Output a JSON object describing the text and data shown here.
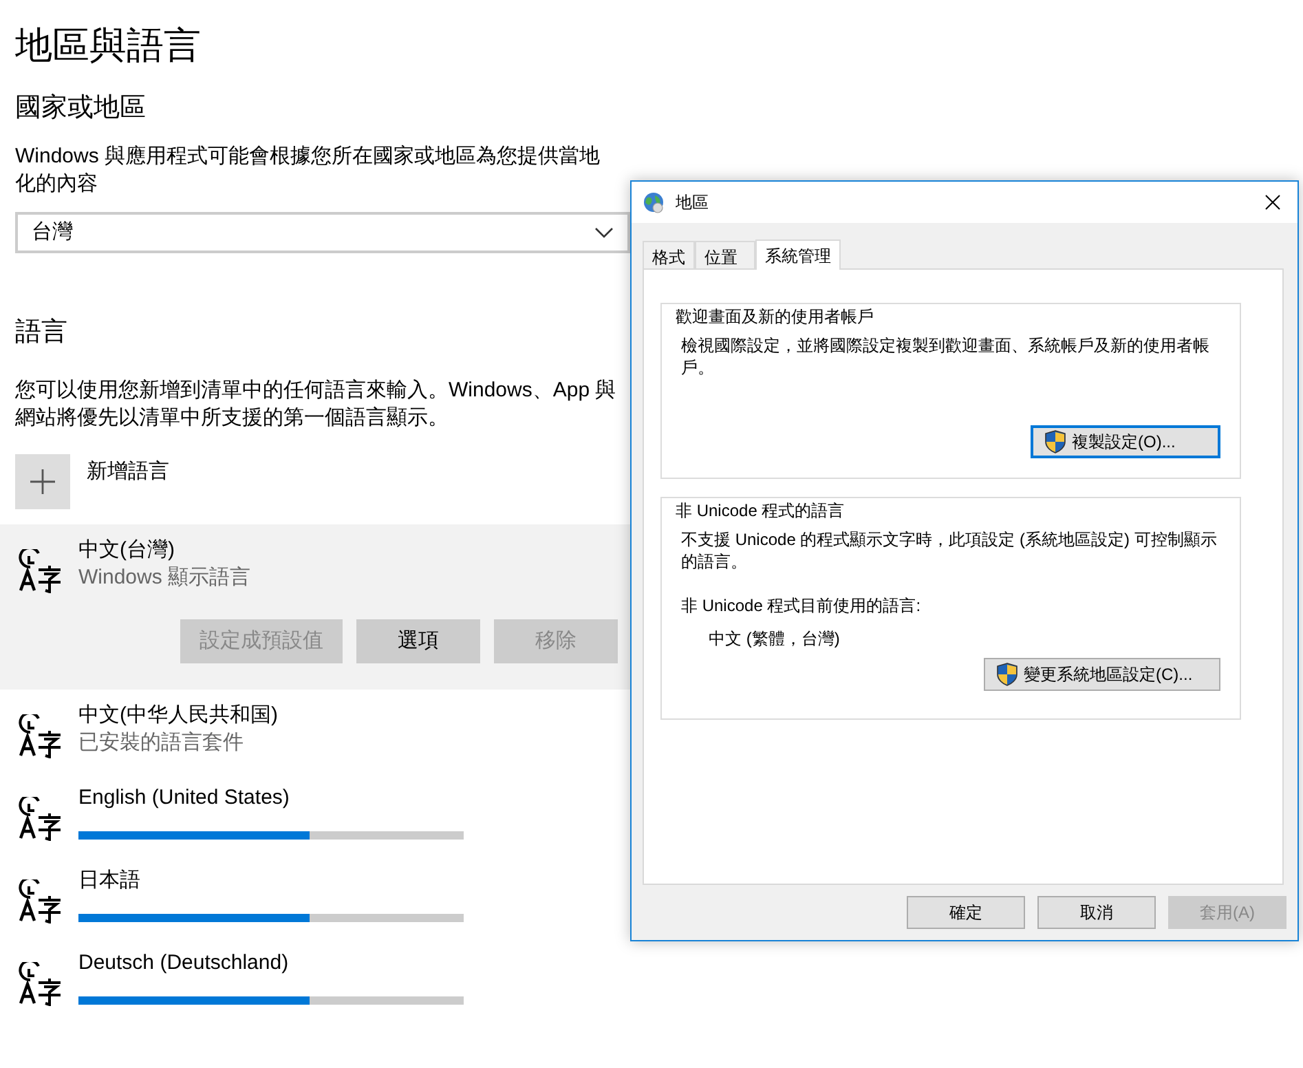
{
  "page": {
    "title": "地區與語言",
    "country_section": {
      "heading": "國家或地區",
      "description": "Windows 與應用程式可能會根據您所在國家或地區為您提供當地化的內容",
      "dropdown": {
        "value": "台灣"
      }
    },
    "language_section": {
      "heading": "語言",
      "description": "您可以使用您新增到清單中的任何語言來輸入。Windows、App 與網站將優先以清單中所支援的第一個語言顯示。",
      "add_button": {
        "label": "新增語言"
      },
      "languages": [
        {
          "name": "中文(台灣)",
          "subtitle": "Windows 顯示語言",
          "selected": true,
          "actions": [
            {
              "label": "設定成預設值",
              "disabled": true
            },
            {
              "label": "選項",
              "disabled": false
            },
            {
              "label": "移除",
              "disabled": true
            }
          ]
        },
        {
          "name": "中文(中华人民共和国)",
          "subtitle": "已安裝的語言套件",
          "selected": false
        },
        {
          "name": "English (United States)",
          "level": 0.6,
          "selected": false
        },
        {
          "name": "日本語",
          "level": 0.6,
          "selected": false
        },
        {
          "name": "Deutsch (Deutschland)",
          "level": 0.6,
          "selected": false
        }
      ]
    }
  },
  "dialog": {
    "title": "地區",
    "tabs": [
      {
        "label": "格式",
        "selected": false
      },
      {
        "label": "位置",
        "selected": false
      },
      {
        "label": "系統管理",
        "selected": true
      }
    ],
    "groups": [
      {
        "title": "歡迎畫面及新的使用者帳戶",
        "text": "檢視國際設定，並將國際設定複製到歡迎畫面、系統帳戶及新的使用者帳戶。",
        "button": {
          "label": "複製設定(O)...",
          "focused": true
        }
      },
      {
        "title": "非 Unicode 程式的語言",
        "text": "不支援 Unicode 的程式顯示文字時，此項設定 (系統地區設定) 可控制顯示的語言。",
        "info_label": "非 Unicode 程式目前使用的語言:",
        "info_value": "中文 (繁體，台灣)",
        "button": {
          "label": "變更系統地區設定(C)...",
          "focused": false
        }
      }
    ],
    "buttons": [
      {
        "label": "確定",
        "disabled": false
      },
      {
        "label": "取消",
        "disabled": false
      },
      {
        "label": "套用(A)",
        "disabled": true
      }
    ]
  }
}
